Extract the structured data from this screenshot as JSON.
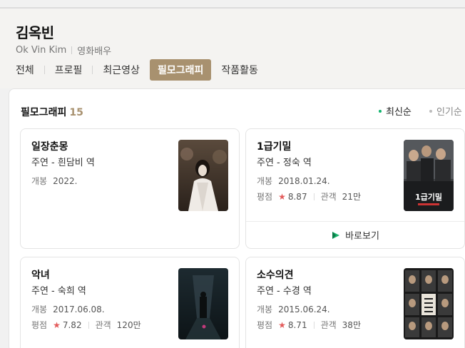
{
  "profile": {
    "name": "김옥빈",
    "english_name": "Ok Vin Kim",
    "occupation": "영화배우"
  },
  "tabs": [
    {
      "label": "전체"
    },
    {
      "label": "프로필"
    },
    {
      "label": "최근영상"
    },
    {
      "label": "필모그래피",
      "active": true
    },
    {
      "label": "작품활동"
    }
  ],
  "filmography": {
    "title": "필모그래피",
    "count": "15",
    "sort_newest": "최신순",
    "sort_popular": "인기순",
    "release_label": "개봉",
    "rating_label": "평점",
    "audience_label": "관객",
    "watch_label": "바로보기",
    "works": [
      {
        "title": "일장춘몽",
        "role": "주연 - 흰담비 역",
        "release": "2022."
      },
      {
        "title": "1급기밀",
        "role": "주연 - 정숙 역",
        "release": "2018.01.24.",
        "rating": "8.87",
        "audience": "21만",
        "poster_text": "1급기밀"
      },
      {
        "title": "악녀",
        "role": "주연 - 숙희 역",
        "release": "2017.06.08.",
        "rating": "7.82",
        "audience": "120만"
      },
      {
        "title": "소수의견",
        "role": "주연 - 수경 역",
        "release": "2015.06.24.",
        "rating": "8.71",
        "audience": "38만"
      }
    ]
  },
  "colors": {
    "accent": "#a8916f",
    "rating_star": "#e35b5b",
    "active_dot": "#10b46e"
  }
}
